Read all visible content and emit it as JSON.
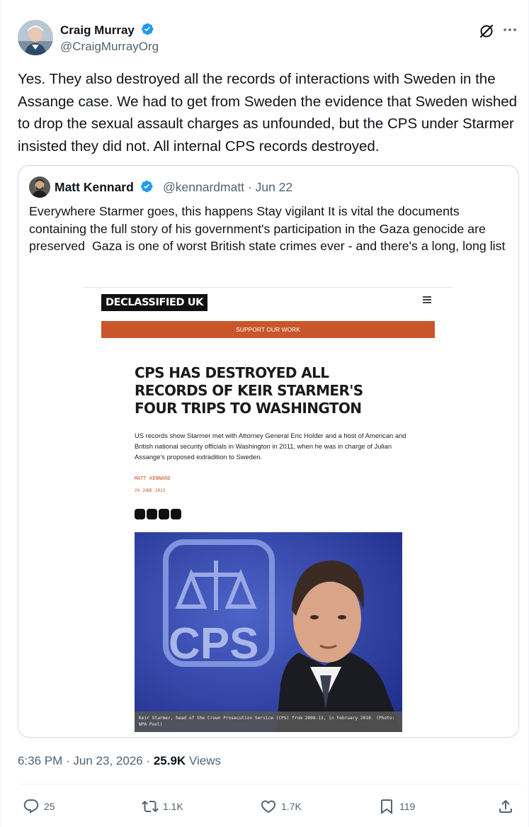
{
  "author": {
    "name": "Craig Murray",
    "handle": "@CraigMurrayOrg"
  },
  "tweet": {
    "text": "Yes. They also destroyed all the records of interactions with Sweden in the Assange case. We had to get from Sweden the evidence that Sweden wished to drop the sexual assault charges as unfounded, but the CPS under Starmer insisted they did not. All internal CPS records destroyed."
  },
  "quote": {
    "name": "Matt Kennard",
    "handle": "@kennardmatt",
    "date_sep": " · ",
    "date": "Jun 22",
    "text": "Everywhere Starmer goes, this happens Stay vigilant It is vital the documents containing the full story of his government's participation in the Gaza genocide are preserved  Gaza is one of worst British state crimes ever - and there's a long, long list",
    "article": {
      "brand": "DECLASSIFIED UK",
      "support": "SUPPORT OUR WORK",
      "headline": "CPS HAS DESTROYED ALL RECORDS OF KEIR STARMER'S FOUR TRIPS TO WASHINGTON",
      "standfirst": "US records show Starmer met with Attorney General Eric Holder and a host of American and British national security officials in Washington in 2011, when he was in charge of Julian Assange's proposed extradition to Sweden.",
      "byline": "MATT KENNARD",
      "date": "29 JUNE 2023",
      "photo_logo": "CPS",
      "caption": "Keir Starmer, head of the Crown Prosecution Service (CPS) from 2008-13, in February 2010. (Photo: WPA Pool)"
    }
  },
  "meta": {
    "time": "6:36 PM · Jun 23, 2026 · ",
    "views_count": "25.9K",
    "views_label": " Views"
  },
  "actions": {
    "replies": "25",
    "reposts": "1.1K",
    "likes": "1.7K",
    "bookmarks": "119"
  },
  "colors": {
    "verified": "#1d9bf0",
    "accent_orange": "#c9562b",
    "secondary_text": "#536471"
  }
}
